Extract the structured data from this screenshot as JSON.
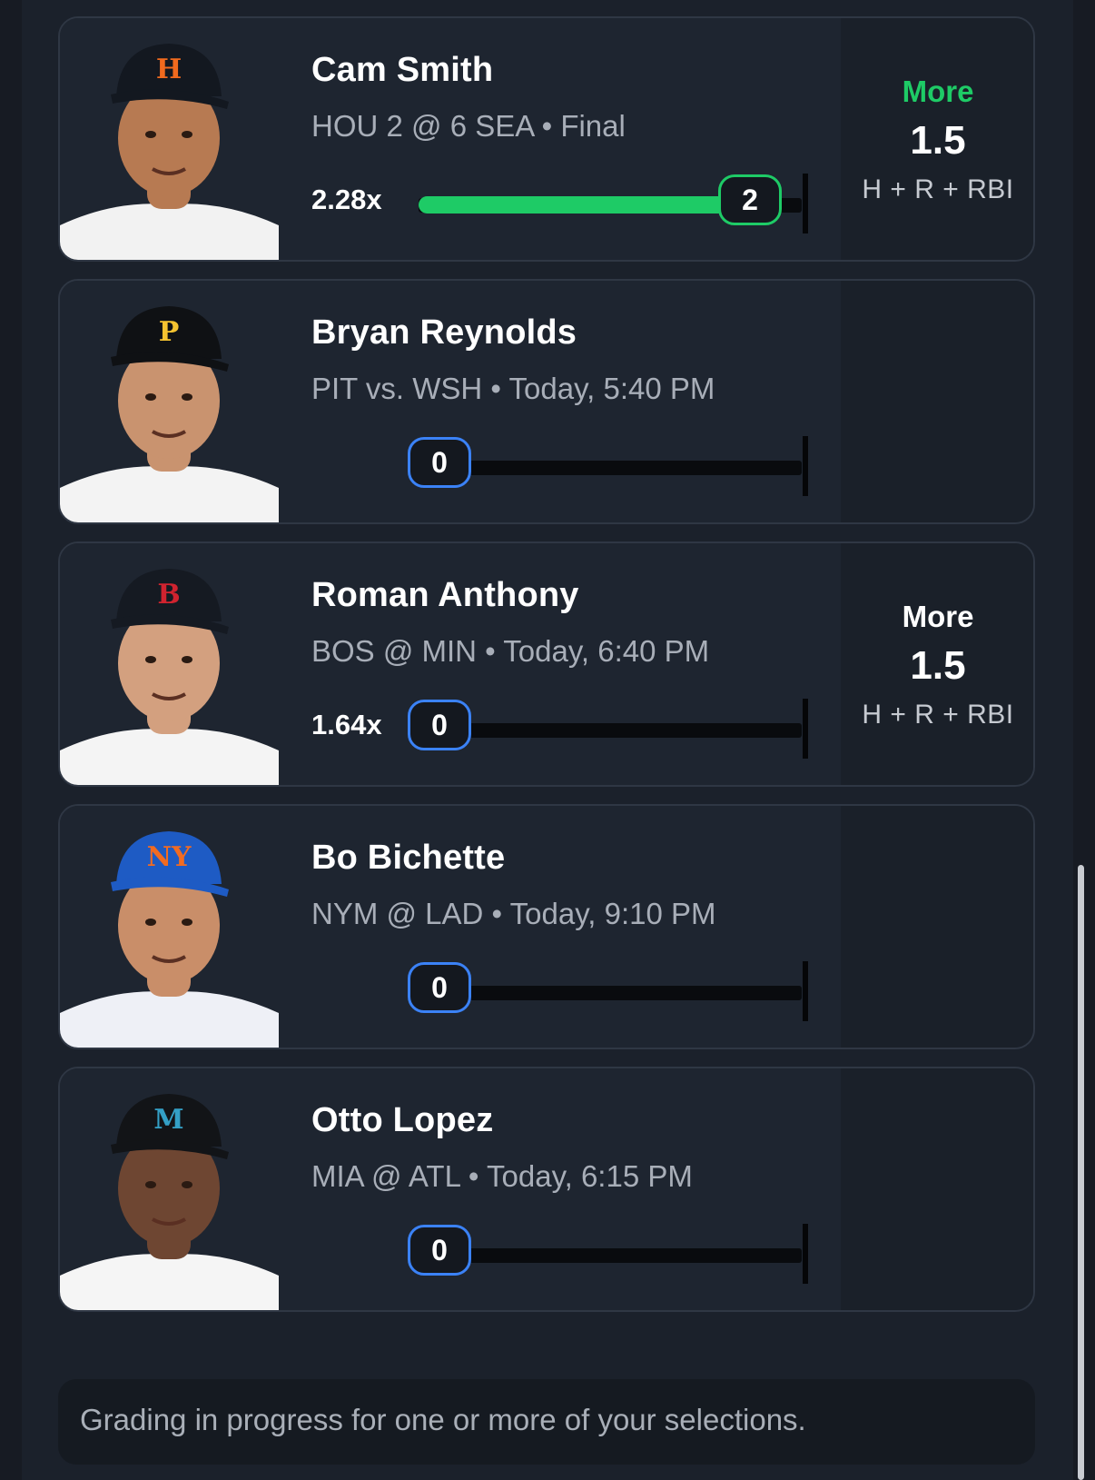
{
  "cards": [
    {
      "player": "Cam Smith",
      "game": "HOU 2 @ 6 SEA • Final",
      "multiplier": "2.28x",
      "current": "2",
      "progress": 1.0,
      "pick": {
        "direction": "More",
        "line": "1.5",
        "stat": "H + R + RBI",
        "status": "won"
      },
      "team_color": "#f06a1e",
      "cap_logo": "H"
    },
    {
      "player": "Bryan Reynolds",
      "game": "PIT vs. WSH • Today, 5:40 PM",
      "multiplier": "",
      "current": "0",
      "progress": 0,
      "pick": null,
      "team_color": "#f5c330",
      "cap_logo": "P"
    },
    {
      "player": "Roman Anthony",
      "game": "BOS @ MIN • Today, 6:40 PM",
      "multiplier": "1.64x",
      "current": "0",
      "progress": 0,
      "pick": {
        "direction": "More",
        "line": "1.5",
        "stat": "H + R + RBI",
        "status": "pending"
      },
      "team_color": "#d0232f",
      "cap_logo": "B"
    },
    {
      "player": "Bo Bichette",
      "game": "NYM @ LAD • Today, 9:10 PM",
      "multiplier": "",
      "current": "0",
      "progress": 0,
      "pick": null,
      "team_color": "#f26b21",
      "cap_logo": "NY"
    },
    {
      "player": "Otto Lopez",
      "game": "MIA @ ATL • Today, 6:15 PM",
      "multiplier": "",
      "current": "0",
      "progress": 0,
      "pick": null,
      "team_color": "#34a0c6",
      "cap_logo": "M"
    }
  ],
  "footer": {
    "message": "Grading in progress for one or more of your selections."
  },
  "colors": {
    "accent_green": "#1ecb66",
    "accent_blue": "#3b82f6",
    "background": "#1b212b"
  }
}
